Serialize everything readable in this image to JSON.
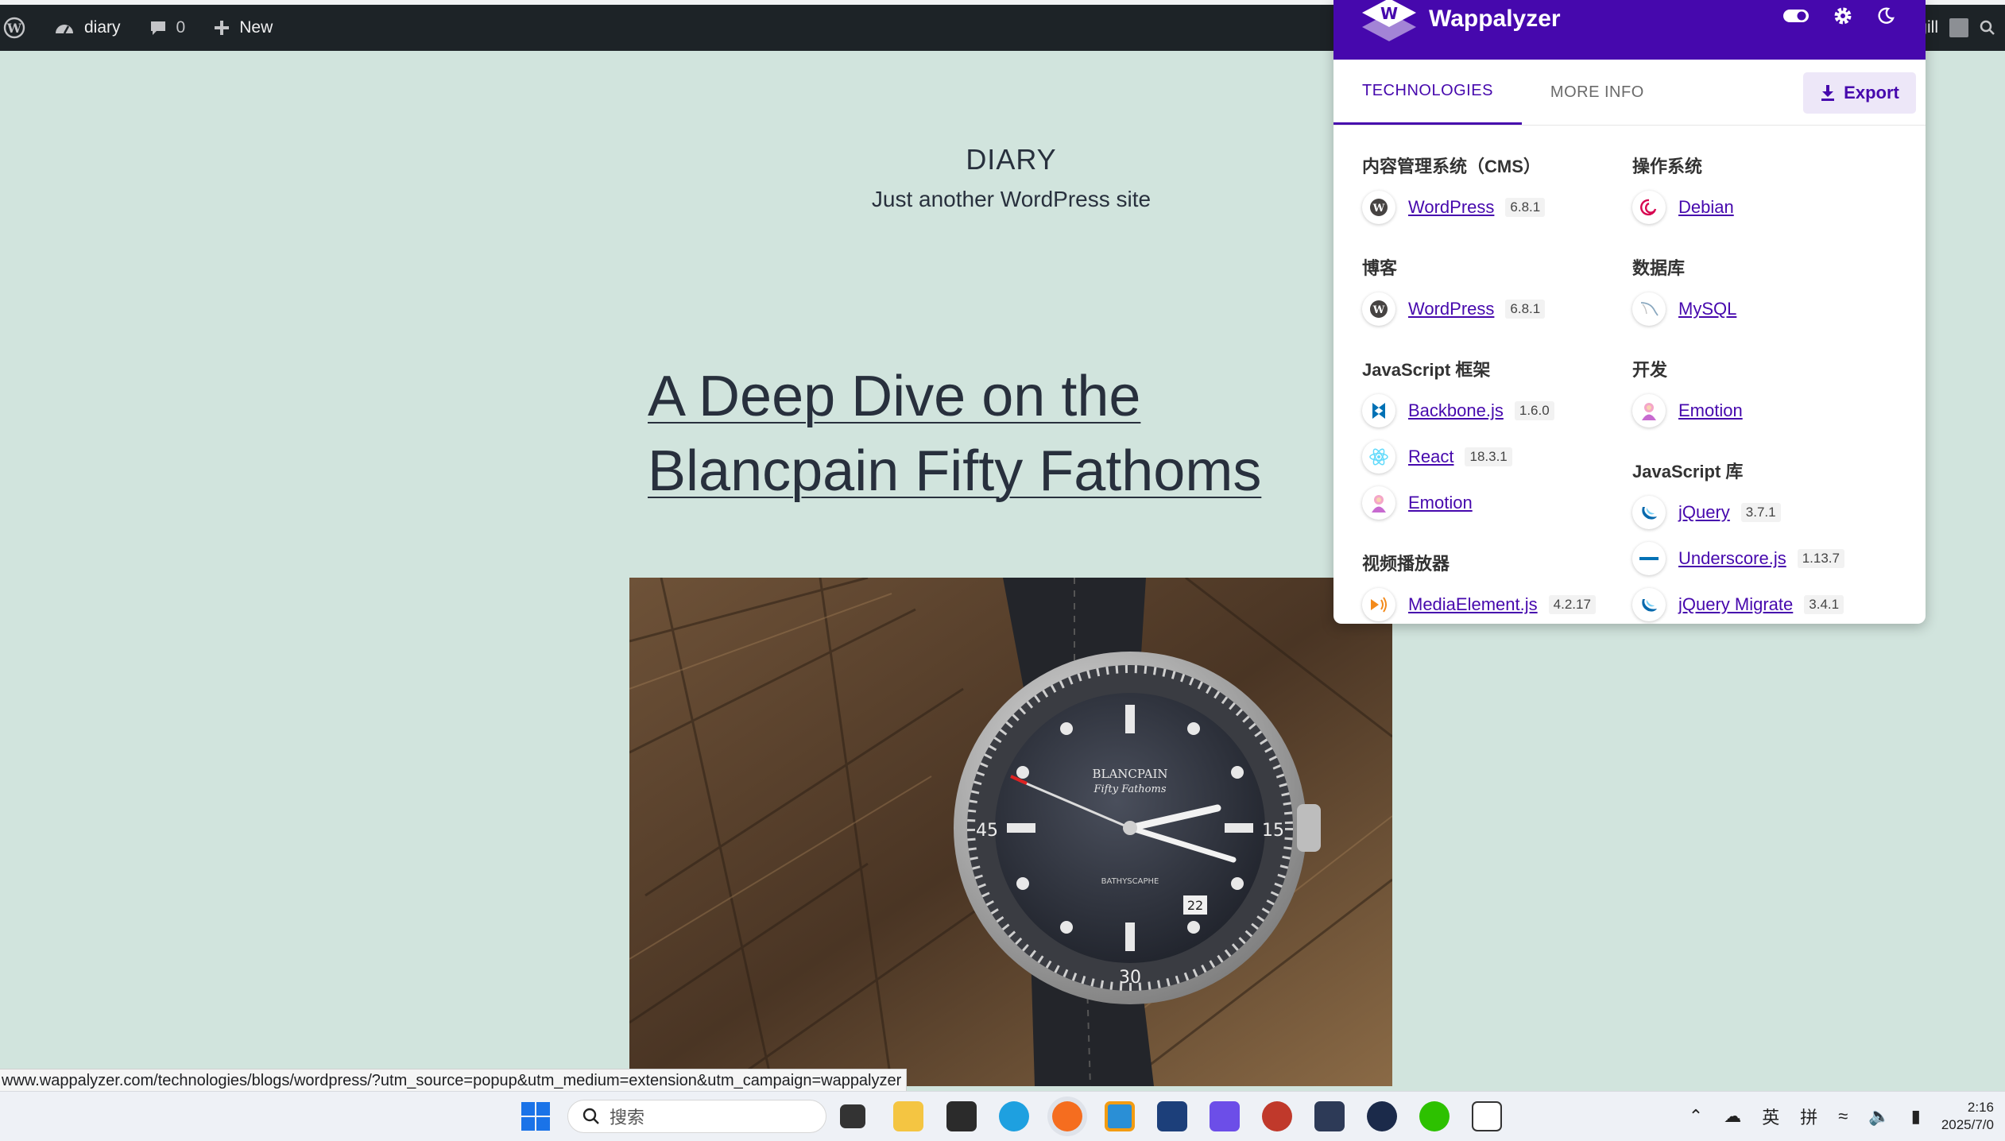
{
  "adminbar": {
    "site_name": "diary",
    "comments_count": "0",
    "new_label": "New",
    "user_greeting": ", gill"
  },
  "site": {
    "title": "DIARY",
    "description": "Just another WordPress site"
  },
  "post": {
    "title_line1": "A Deep Dive on the",
    "title_line2": "Blancpain Fifty Fathoms"
  },
  "photo": {
    "dial_brand": "BLANCPAIN",
    "dial_model": "Fifty Fathoms",
    "dial_sub": "BATHYSCAPHE",
    "date_window": "22",
    "bezel_15": "15",
    "bezel_30": "30",
    "bezel_45": "45"
  },
  "status_url": "www.wappalyzer.com/technologies/blogs/wordpress/?utm_source=popup&utm_medium=extension&utm_campaign=wappalyzer",
  "wappalyzer": {
    "brand": "Wappalyzer",
    "accent": "#4608ad",
    "tabs": [
      "TECHNOLOGIES",
      "MORE INFO"
    ],
    "export_label": "Export",
    "left_column": [
      {
        "category": "内容管理系统（CMS）",
        "techs": [
          {
            "name": "WordPress",
            "version": "6.8.1",
            "icon": "wordpress-icon"
          }
        ]
      },
      {
        "category": "博客",
        "techs": [
          {
            "name": "WordPress",
            "version": "6.8.1",
            "icon": "wordpress-icon"
          }
        ]
      },
      {
        "category": "JavaScript 框架",
        "techs": [
          {
            "name": "Backbone.js",
            "version": "1.6.0",
            "icon": "backbone-icon"
          },
          {
            "name": "React",
            "version": "18.3.1",
            "icon": "react-icon"
          },
          {
            "name": "Emotion",
            "version": "",
            "icon": "emotion-icon"
          }
        ]
      },
      {
        "category": "视频播放器",
        "techs": [
          {
            "name": "MediaElement.js",
            "version": "4.2.17",
            "icon": "mediaelement-icon"
          }
        ]
      }
    ],
    "right_column": [
      {
        "category": "操作系统",
        "techs": [
          {
            "name": "Debian",
            "version": "",
            "icon": "debian-icon"
          }
        ]
      },
      {
        "category": "数据库",
        "techs": [
          {
            "name": "MySQL",
            "version": "",
            "icon": "mysql-icon"
          }
        ]
      },
      {
        "category": "开发",
        "techs": [
          {
            "name": "Emotion",
            "version": "",
            "icon": "emotion-icon"
          }
        ]
      },
      {
        "category": "JavaScript 库",
        "techs": [
          {
            "name": "jQuery",
            "version": "3.7.1",
            "icon": "jquery-icon"
          },
          {
            "name": "Underscore.js",
            "version": "1.13.7",
            "icon": "underscore-icon"
          },
          {
            "name": "jQuery Migrate",
            "version": "3.4.1",
            "icon": "jquery-icon"
          }
        ]
      }
    ]
  },
  "taskbar": {
    "search_placeholder": "搜索",
    "ime_lang": "英",
    "ime_mode": "拼",
    "clock_time": "2:16",
    "clock_date": "2025/7/0"
  }
}
